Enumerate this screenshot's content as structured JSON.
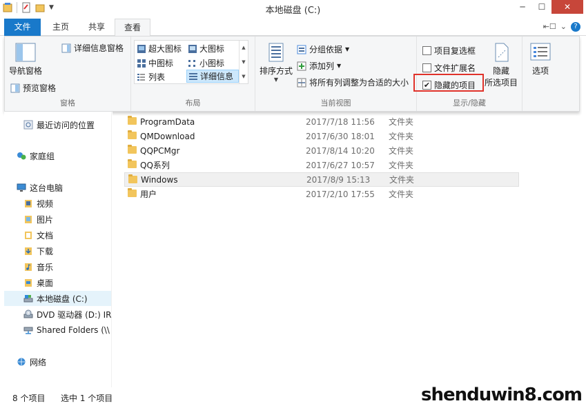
{
  "window": {
    "title": "本地磁盘 (C:)"
  },
  "tabs": {
    "file": "文件",
    "home": "主页",
    "share": "共享",
    "view": "查看"
  },
  "ribbon": {
    "panes": {
      "navigation_pane": "导航窗格",
      "preview_pane": "预览窗格",
      "details_pane": "详细信息窗格",
      "label": "窗格"
    },
    "layout": {
      "extra_large": "超大图标",
      "large": "大图标",
      "medium": "中图标",
      "small": "小图标",
      "list": "列表",
      "details": "详细信息",
      "label": "布局"
    },
    "current_view": {
      "sort_by": "排序方式",
      "group_by": "分组依据",
      "add_columns": "添加列",
      "size_all_columns": "将所有列调整为合适的大小",
      "label": "当前视图"
    },
    "show_hide": {
      "item_checkboxes": "项目复选框",
      "file_extensions": "文件扩展名",
      "hidden_items": "隐藏的项目",
      "hide_selected_1": "隐藏",
      "hide_selected_2": "所选项目",
      "label": "显示/隐藏",
      "item_checkboxes_checked": false,
      "file_extensions_checked": false,
      "hidden_items_checked": true
    },
    "options": "选项"
  },
  "nav": {
    "recent": "最近访问的位置",
    "homegroup": "家庭组",
    "this_pc": "这台电脑",
    "videos": "视频",
    "pictures": "图片",
    "documents": "文档",
    "downloads": "下载",
    "music": "音乐",
    "desktop": "桌面",
    "local_disk": "本地磁盘 (C:)",
    "dvd": "DVD 驱动器 (D:) IR",
    "shared": "Shared Folders (\\\\",
    "network": "网络"
  },
  "files": [
    {
      "name": "ProgramData",
      "date": "2017/7/18 11:56",
      "type": "文件夹"
    },
    {
      "name": "QMDownload",
      "date": "2017/6/30 18:01",
      "type": "文件夹"
    },
    {
      "name": "QQPCMgr",
      "date": "2017/8/14 10:20",
      "type": "文件夹"
    },
    {
      "name": "QQ系列",
      "date": "2017/6/27 10:57",
      "type": "文件夹"
    },
    {
      "name": "Windows",
      "date": "2017/8/9 15:13",
      "type": "文件夹"
    },
    {
      "name": "用户",
      "date": "2017/2/10 17:55",
      "type": "文件夹"
    }
  ],
  "status": {
    "count": "8 个项目",
    "selected": "选中 1 个项目"
  },
  "watermark": "shenduwin8.com",
  "colors": {
    "accent": "#1979ca",
    "highlight_box": "#e0322a",
    "folder": "#f2c55c"
  }
}
